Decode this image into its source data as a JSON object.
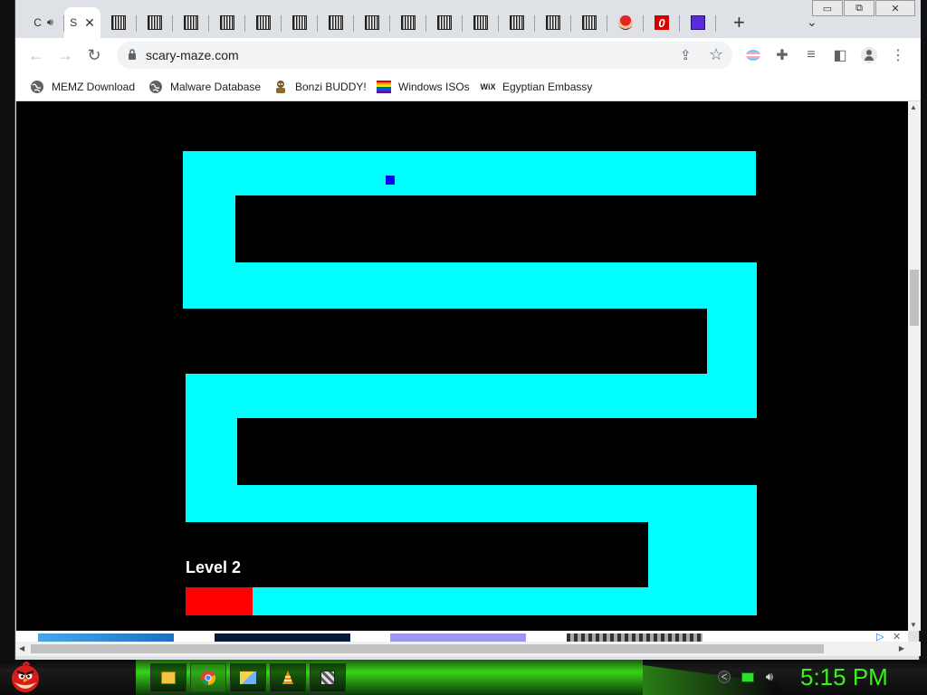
{
  "browser": {
    "tabs": [
      {
        "label": "C",
        "icon": "speaker-icon",
        "active": false
      },
      {
        "label": "S",
        "icon": "",
        "active": true
      },
      {
        "label": "",
        "icon": "qr-favicon-icon"
      },
      {
        "label": "",
        "icon": "qr-favicon-icon"
      },
      {
        "label": "",
        "icon": "qr-favicon-icon"
      },
      {
        "label": "",
        "icon": "qr-favicon-icon"
      },
      {
        "label": "",
        "icon": "qr-favicon-icon"
      },
      {
        "label": "",
        "icon": "qr-favicon-icon"
      },
      {
        "label": "",
        "icon": "qr-favicon-icon"
      },
      {
        "label": "",
        "icon": "qr-favicon-icon"
      },
      {
        "label": "",
        "icon": "qr-favicon-icon"
      },
      {
        "label": "",
        "icon": "qr-favicon-icon"
      },
      {
        "label": "",
        "icon": "qr-favicon-icon"
      },
      {
        "label": "",
        "icon": "qr-favicon-icon"
      },
      {
        "label": "",
        "icon": "mario-favicon-icon"
      },
      {
        "label": "",
        "icon": "opera-favicon-icon"
      },
      {
        "label": "",
        "icon": "purple-face-favicon-icon"
      }
    ],
    "active_tab_close": "✕",
    "new_tab": "+",
    "tab_search": "⌄",
    "window_controls": {
      "minimize": "▭",
      "restore": "⧉",
      "close": "✕"
    },
    "address": {
      "url": "scary-maze.com"
    },
    "bookmarks": [
      {
        "label": "MEMZ Download",
        "icon": "globe-icon"
      },
      {
        "label": "Malware Database",
        "icon": "globe-icon"
      },
      {
        "label": "Bonzi BUDDY!",
        "icon": "bonzi-icon"
      },
      {
        "label": "Windows ISOs",
        "icon": "rainbow-flag-icon"
      },
      {
        "label": "Egyptian Embassy",
        "icon": "wix-icon",
        "icon_text": "WiX"
      }
    ]
  },
  "game": {
    "level_label": "Level 2",
    "colors": {
      "background": "#000000",
      "path": "#00ffff",
      "player": "#0000ff",
      "start": "#ff0000"
    }
  },
  "ad": {
    "close": "✕",
    "adchoices": "▷"
  },
  "taskbar": {
    "clock": "5:15 PM",
    "items": [
      {
        "name": "file-explorer-icon"
      },
      {
        "name": "chrome-icon"
      },
      {
        "name": "folder-windows-icon"
      },
      {
        "name": "vlc-icon"
      },
      {
        "name": "app-icon"
      }
    ]
  }
}
